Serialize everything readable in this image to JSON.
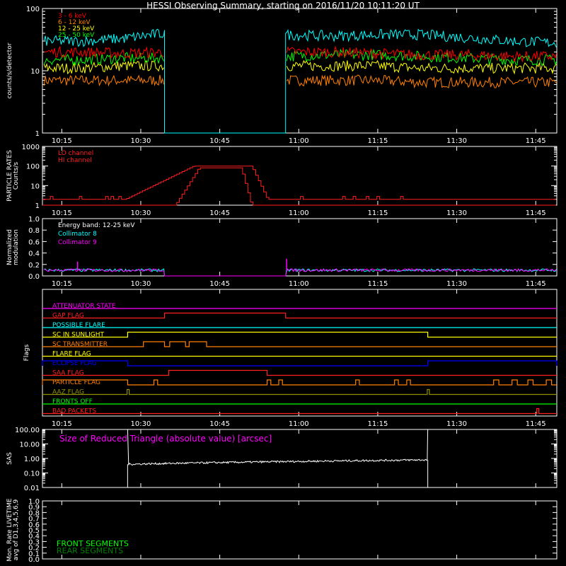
{
  "title": "HESSI Observing Summary, starting on 2016/11/20 10:11:20 UT",
  "time_axis": {
    "start_min": 611.33,
    "end_min": 709,
    "tick_minutes": [
      615,
      630,
      645,
      660,
      675,
      690,
      705
    ],
    "tick_labels": [
      "10:15",
      "10:30",
      "10:45",
      "11:00",
      "11:15",
      "11:30",
      "11:45"
    ]
  },
  "chart_data": [
    {
      "type": "line",
      "panel": "count_rates",
      "ylabel": "counts/s/detector",
      "yscale": "log",
      "ylim": [
        1,
        100
      ],
      "ytick_labels": [
        "1",
        "10",
        "100"
      ],
      "gap_minutes": [
        634.5,
        657.5
      ],
      "series": [
        {
          "name": "3 - 6 keV",
          "color": "#ff0000",
          "values_before_gap": [
            20,
            20,
            19,
            20
          ],
          "values_after_gap": [
            20,
            20,
            19,
            18,
            18,
            17,
            17
          ]
        },
        {
          "name": "6 - 12 keV",
          "color": "#ff8000",
          "values_before_gap": [
            7,
            7,
            7,
            7
          ],
          "values_after_gap": [
            7,
            7,
            7,
            6.5,
            6.5,
            6.5,
            6.5
          ]
        },
        {
          "name": "12 - 25 keV",
          "color": "#ffff00",
          "values_before_gap": [
            11,
            11,
            12,
            12
          ],
          "values_after_gap": [
            12,
            12,
            12,
            11,
            11,
            11,
            11
          ]
        },
        {
          "name": "25 - 50 keV",
          "color": "#00ff00",
          "values_before_gap": [
            15,
            15,
            16,
            16
          ],
          "values_after_gap": [
            17,
            18,
            18,
            17,
            16,
            15,
            15
          ]
        },
        {
          "name": "",
          "color": "#00ffff",
          "values_before_gap": [
            30,
            30,
            33,
            40
          ],
          "values_after_gap": [
            38,
            36,
            38,
            38,
            34,
            30,
            28
          ]
        }
      ]
    },
    {
      "type": "line",
      "panel": "particle_rates",
      "ylabel": "PARTICLE RATES Counts/s",
      "yscale": "log",
      "ylim": [
        1,
        1000
      ],
      "ytick_labels": [
        "1",
        "10",
        "100",
        "1000"
      ],
      "series": [
        {
          "name": "LO channel",
          "color": "#ff2020",
          "baseline": 2,
          "peak": 100,
          "rise_start": 627,
          "plateau_start": 640,
          "plateau_end": 651,
          "fall_end": 654
        },
        {
          "name": "HI channel",
          "color": "#ff2020",
          "baseline": 1,
          "peak": 80,
          "rise_start": 636.5,
          "plateau_start": 641,
          "plateau_end": 649,
          "fall_end": 651
        }
      ]
    },
    {
      "type": "line",
      "panel": "modulation",
      "ylabel": "Normalized modulation",
      "ylim": [
        0,
        1
      ],
      "ytick_labels": [
        "0.0",
        "0.2",
        "0.4",
        "0.6",
        "0.8",
        "1.0"
      ],
      "annotation": "Energy band: 12-25 keV",
      "series": [
        {
          "name": "Collimator 8",
          "color": "#00ffff",
          "level": 0.1
        },
        {
          "name": "Collimator 9",
          "color": "#ff00ff",
          "level": 0.1
        }
      ],
      "gap_minutes": [
        634.5,
        657.5
      ],
      "spikes": [
        {
          "t": 618,
          "v": 0.25
        },
        {
          "t": 657.7,
          "v": 0.3
        }
      ]
    },
    {
      "type": "table",
      "panel": "flags",
      "ylabel": "Flags",
      "rows": [
        {
          "label": "ATTENUATOR STATE",
          "color": "#ff00ff",
          "segments": []
        },
        {
          "label": "GAP FLAG",
          "color": "#ff2020",
          "segments": [
            [
              634.5,
              657.5
            ]
          ]
        },
        {
          "label": "POSSIBLE FLARE",
          "color": "#00ffff",
          "segments": []
        },
        {
          "label": "SC IN SUNLIGHT",
          "color": "#ffff00",
          "segments": [
            [
              611.33,
              627.5
            ],
            [
              684.5,
              709
            ]
          ],
          "inverted": true
        },
        {
          "label": "SC TRANSMITTER",
          "color": "#ff8000",
          "segments": [
            [
              630.5,
              634.5
            ],
            [
              635.5,
              638.5
            ],
            [
              639.2,
              642.5
            ]
          ]
        },
        {
          "label": "FLARE FLAG",
          "color": "#ffff00",
          "segments": []
        },
        {
          "label": "ECLIPSE FLAG",
          "color": "#0000ff",
          "segments": [
            [
              611.33,
              627.5
            ],
            [
              684.5,
              709
            ]
          ]
        },
        {
          "label": "SAA FLAG",
          "color": "#ff2020",
          "segments": [
            [
              635.3,
              654
            ]
          ]
        },
        {
          "label": "PARTICLE FLAG",
          "color": "#ff8000",
          "segments": [
            [
              611.33,
              627.5
            ],
            [
              632.5,
              633.2
            ],
            [
              654,
              654.7
            ],
            [
              656.2,
              656.9
            ],
            [
              670.8,
              671.5
            ],
            [
              678.2,
              678.9
            ],
            [
              680.5,
              681.2
            ],
            [
              697,
              698
            ],
            [
              700.5,
              701.5
            ],
            [
              703.5,
              704.5
            ],
            [
              707,
              708
            ]
          ]
        },
        {
          "label": "AAZ FLAG",
          "color": "#909000",
          "segments": [
            [
              627.4,
              627.8
            ],
            [
              684.4,
              684.8
            ]
          ]
        },
        {
          "label": "FRONTS OFF",
          "color": "#00ff00",
          "segments": []
        },
        {
          "label": "BAD PACKETS",
          "color": "#ff2020",
          "segments": [
            [
              705.2,
              705.6
            ]
          ]
        }
      ]
    },
    {
      "type": "line",
      "panel": "sas",
      "ylabel": "SAS",
      "yscale": "log",
      "ylim": [
        0.01,
        100
      ],
      "ytick_labels": [
        "0.01",
        "0.10",
        "1.00",
        "10.00",
        "100.00"
      ],
      "annotation": "Size of Reduced Triangle (absolute value) [arcsec]",
      "series": [
        {
          "name": "",
          "color": "#ffffff",
          "start": 627.5,
          "end": 684.5,
          "level_start": 0.4,
          "level_end": 0.8
        }
      ]
    },
    {
      "type": "line",
      "panel": "livetime",
      "ylabel": "Mon. Rate LIVETIME avg of D1,3,4,5,6,9",
      "ylim": [
        0,
        1
      ],
      "ytick_labels": [
        "0.0",
        "0.1",
        "0.2",
        "0.3",
        "0.4",
        "0.5",
        "0.6",
        "0.7",
        "0.8",
        "0.9",
        "1.0"
      ],
      "series": [
        {
          "name": "FRONT SEGMENTS",
          "color": "#00ff00"
        },
        {
          "name": "REAR SEGMENTS",
          "color": "#008000"
        }
      ]
    }
  ]
}
